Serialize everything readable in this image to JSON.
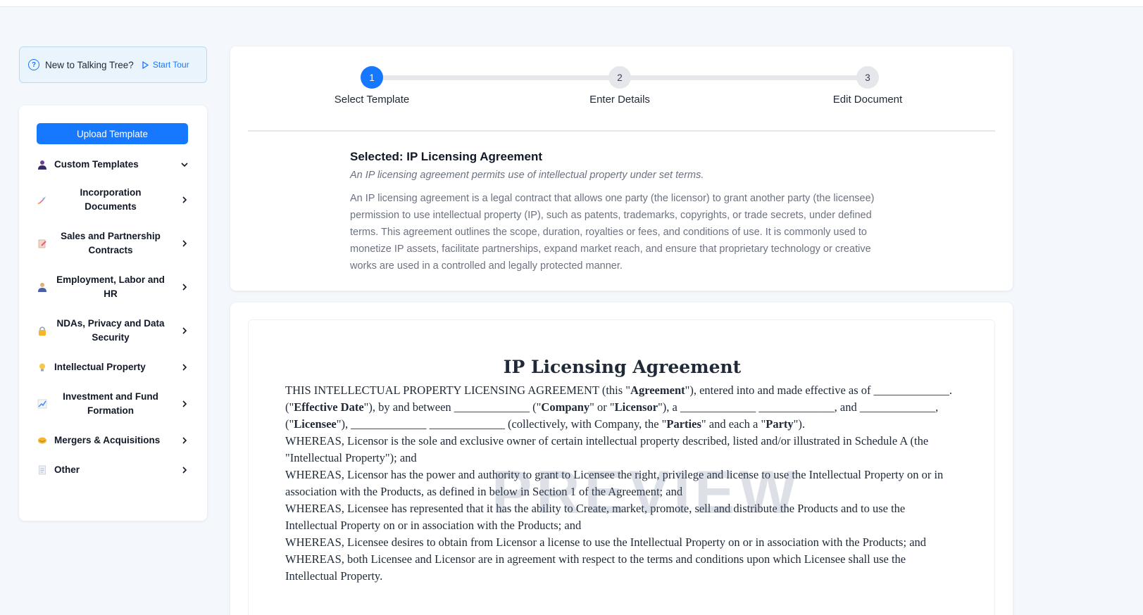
{
  "tour": {
    "text": "New to Talking Tree?",
    "start_label": "Start Tour"
  },
  "sidebar": {
    "upload_label": "Upload Template",
    "categories": [
      {
        "label": "Custom Templates",
        "icon": "person-icon",
        "chevron": "down"
      },
      {
        "label": "Incorporation Documents",
        "icon": "rocket-icon",
        "chevron": "right"
      },
      {
        "label": "Sales and Partnership Contracts",
        "icon": "memo-icon",
        "chevron": "right"
      },
      {
        "label": "Employment, Labor and HR",
        "icon": "worker-icon",
        "chevron": "right"
      },
      {
        "label": "NDAs, Privacy and Data Security",
        "icon": "lock-icon",
        "chevron": "right"
      },
      {
        "label": "Intellectual Property",
        "icon": "lightbulb-icon",
        "chevron": "right"
      },
      {
        "label": "Investment and Fund Formation",
        "icon": "chart-icon",
        "chevron": "right"
      },
      {
        "label": "Mergers & Acquisitions",
        "icon": "handshake-icon",
        "chevron": "right"
      },
      {
        "label": "Other",
        "icon": "document-icon",
        "chevron": "right"
      }
    ]
  },
  "steps": [
    {
      "number": "1",
      "label": "Select Template",
      "active": true
    },
    {
      "number": "2",
      "label": "Enter Details",
      "active": false
    },
    {
      "number": "3",
      "label": "Edit Document",
      "active": false
    }
  ],
  "selected": {
    "title": "Selected: IP Licensing Agreement",
    "subtitle": "An IP licensing agreement permits use of intellectual property under set terms.",
    "description": "An IP licensing agreement is a legal contract that allows one party (the licensor) to grant another party (the licensee) permission to use intellectual property (IP), such as patents, trademarks, copyrights, or trade secrets, under defined terms. This agreement outlines the scope, duration, royalties or fees, and conditions of use. It is commonly used to monetize IP assets, facilitate partnerships, expand market reach, and ensure that proprietary technology or creative works are used in a controlled and legally protected manner."
  },
  "document": {
    "title": "IP Licensing Agreement",
    "watermark": "PREVIEW",
    "p1": {
      "a": "THIS INTELLECTUAL PROPERTY LICENSING AGREEMENT (this \"",
      "b": "Agreement",
      "c": "\"), entered into and made effective as of _____________. (\"",
      "d": "Effective Date",
      "e": "\"), by and between _____________ (\"",
      "f": "Company",
      "g": "\" or \"",
      "h": "Licensor",
      "i": "\"), a _____________ _____________, and _____________, (\"",
      "j": "Licensee",
      "k": "\"), _____________ _____________ (collectively, with Company, the \"",
      "l": "Parties",
      "m": "\" and each a \"",
      "n": "Party",
      "o": "\")."
    },
    "whereas": [
      "WHEREAS, Licensor is the sole and exclusive owner of certain intellectual property described, listed and/or illustrated in Schedule A (the \"Intellectual Property\"); and",
      "WHEREAS, Licensor has the power and authority to grant to Licensee the right, privilege and license to use the Intellectual Property on or in association with the Products, as defined in below in Section 1 of the Agreement; and",
      "WHEREAS, Licensee has represented that it has the ability to Create, market, promote, sell and distribute the Products and to use the Intellectual Property on or in association with the Products; and",
      "WHEREAS, Licensee desires to obtain from Licensor a license to use the Intellectual Property on or in association with the Products; and",
      "WHEREAS, both Licensee and Licensor are in agreement with respect to the terms and conditions upon which Licensee shall use the Intellectual Property."
    ]
  }
}
